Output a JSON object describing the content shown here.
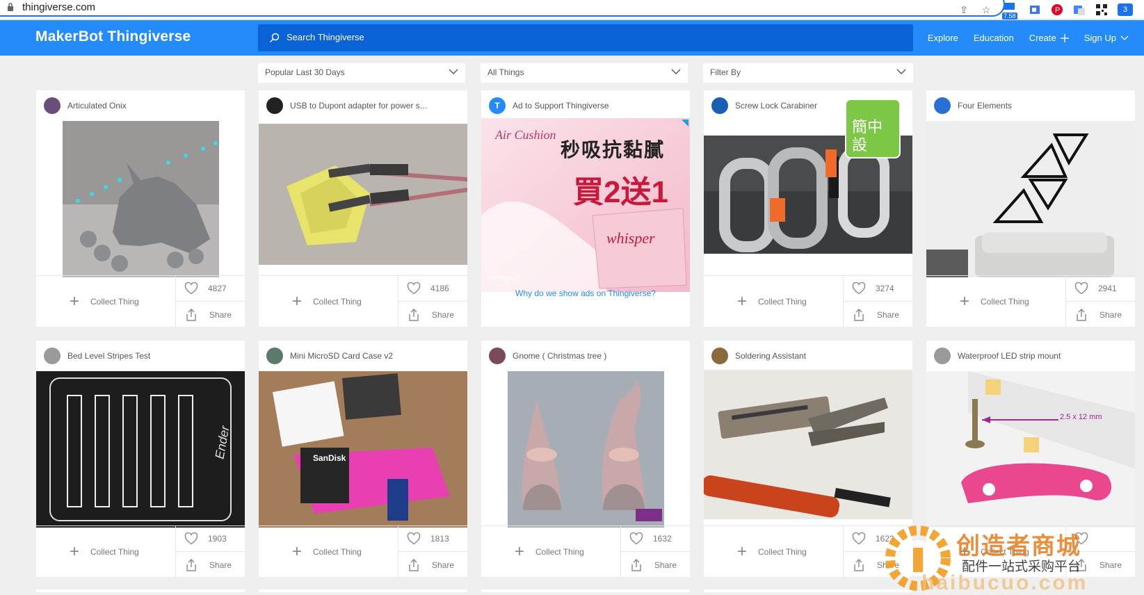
{
  "browser": {
    "url": "thingiverse.com",
    "ext_badge": "7.58",
    "corner_badge": "3"
  },
  "header": {
    "logo": "MakerBot Thingiverse",
    "search_placeholder": "Search Thingiverse",
    "nav": [
      "Explore",
      "Education",
      "Create",
      "Sign Up"
    ]
  },
  "filters": {
    "sort": "Popular Last 30 Days",
    "type": "All Things",
    "filter": "Filter By"
  },
  "labels": {
    "collect": "Collect Thing",
    "share": "Share"
  },
  "cards": [
    {
      "title": "Articulated Onix",
      "likes": "4827",
      "avatar_color": "#6a4d7a"
    },
    {
      "title": "USB to Dupont adapter for power s...",
      "likes": "4186",
      "avatar_color": "#222222"
    },
    {
      "title": "Ad to Support Thingiverse",
      "ad_link": "Why do we show ads on Thingiverse?",
      "avatar_color": "#248bfb"
    },
    {
      "title": "Screw Lock Carabiner",
      "likes": "3274",
      "avatar_color": "#1a5fb4"
    },
    {
      "title": "Four Elements",
      "likes": "2941",
      "avatar_color": "#2a6fd6"
    },
    {
      "title": "Bed Level Stripes Test",
      "likes": "1903",
      "avatar_color": "#9a9a9a"
    },
    {
      "title": "Mini MicroSD Card Case v2",
      "likes": "1813",
      "avatar_color": "#5b7b6a"
    },
    {
      "title": "Gnome ( Christmas tree )",
      "likes": "1632",
      "avatar_color": "#7a4a5a"
    },
    {
      "title": "Soldering Assistant",
      "likes": "1623",
      "avatar_color": "#8a6a3a"
    },
    {
      "title": "Waterproof LED strip mount",
      "likes": "",
      "avatar_color": "#9a9a9a"
    }
  ],
  "ad": {
    "brand": "Air Cushion",
    "headline": "秒吸抗黏膩",
    "offer": "買2送1",
    "product": "whisper",
    "badge": "簡中設"
  },
  "image_text": {
    "ender": "Ender",
    "sandisk": "SanDisk",
    "dimension": "2.5 x 12 mm"
  },
  "watermark": {
    "brand": "创造者商城",
    "subtitle": "配件一站式采购平台",
    "domain": "haibucuo.com"
  }
}
